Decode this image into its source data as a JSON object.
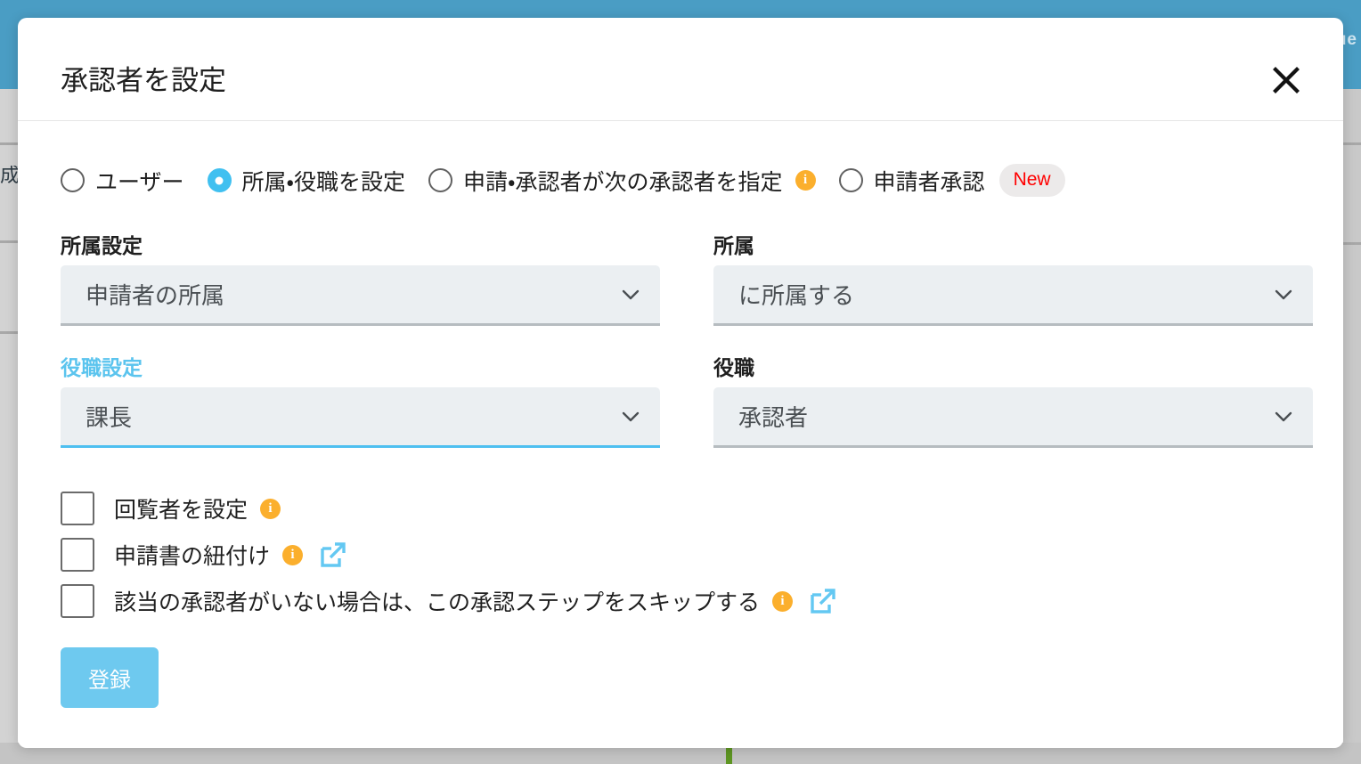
{
  "background": {
    "header_text_fragment": "ue",
    "left_glyph_fragment": "成"
  },
  "modal": {
    "title": "承認者を設定",
    "close_label": "×",
    "approver_type": {
      "options": [
        {
          "label": "ユーザー",
          "selected": false,
          "info": false,
          "badge": null
        },
        {
          "label": "所属・役職を設定",
          "selected": true,
          "info": false,
          "badge": null
        },
        {
          "label": "申請・承認者が次の承認者を指定",
          "selected": false,
          "info": true,
          "badge": null
        },
        {
          "label": "申請者承認",
          "selected": false,
          "info": false,
          "badge": "New"
        }
      ]
    },
    "fields": [
      {
        "label": "所属設定",
        "value": "申請者の所属",
        "focused": false
      },
      {
        "label": "所属",
        "value": "に所属する",
        "focused": false
      },
      {
        "label": "役職設定",
        "value": "課長",
        "focused": true
      },
      {
        "label": "役職",
        "value": "承認者",
        "focused": false
      }
    ],
    "checkboxes": [
      {
        "label": "回覧者を設定",
        "checked": false,
        "info": true,
        "external_link": false
      },
      {
        "label": "申請書の紐付け",
        "checked": false,
        "info": true,
        "external_link": true
      },
      {
        "label": "該当の承認者がいない場合は、この承認ステップをスキップする",
        "checked": false,
        "info": true,
        "external_link": true
      }
    ],
    "submit_label": "登録"
  },
  "colors": {
    "accent_blue": "#4ebff0",
    "button_blue": "#6ec9ef",
    "info_orange": "#fbaf2d",
    "badge_red": "#ff0000",
    "header_blue": "#4a9dc4",
    "field_bg": "#ebeff2"
  }
}
